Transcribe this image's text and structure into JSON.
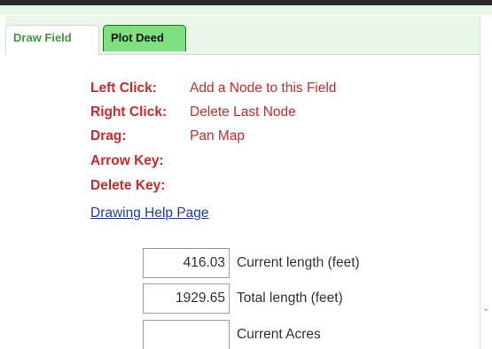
{
  "tabs": [
    {
      "label": "Draw Field"
    },
    {
      "label": "Plot Deed"
    }
  ],
  "help": [
    {
      "key": "Left Click:",
      "desc": "Add a Node to this Field"
    },
    {
      "key": "Right Click:",
      "desc": "Delete Last Node"
    },
    {
      "key": "Drag:",
      "desc": "Pan Map"
    },
    {
      "key": "Arrow Key:",
      "desc": ""
    },
    {
      "key": "Delete Key:",
      "desc": ""
    }
  ],
  "help_link": "Drawing Help Page",
  "fields": [
    {
      "value": "416.03",
      "label": "Current length (feet)"
    },
    {
      "value": "1929.65",
      "label": "Total length (feet)"
    },
    {
      "value": "",
      "label": "Current Acres"
    }
  ],
  "scroll_indicator": "ˇ",
  "colors": {
    "help_text": "#cc2a2a",
    "link": "#1a3cc8",
    "active_tab_text": "#3d9a3d",
    "inactive_tab_bg": "#7fe07f"
  }
}
